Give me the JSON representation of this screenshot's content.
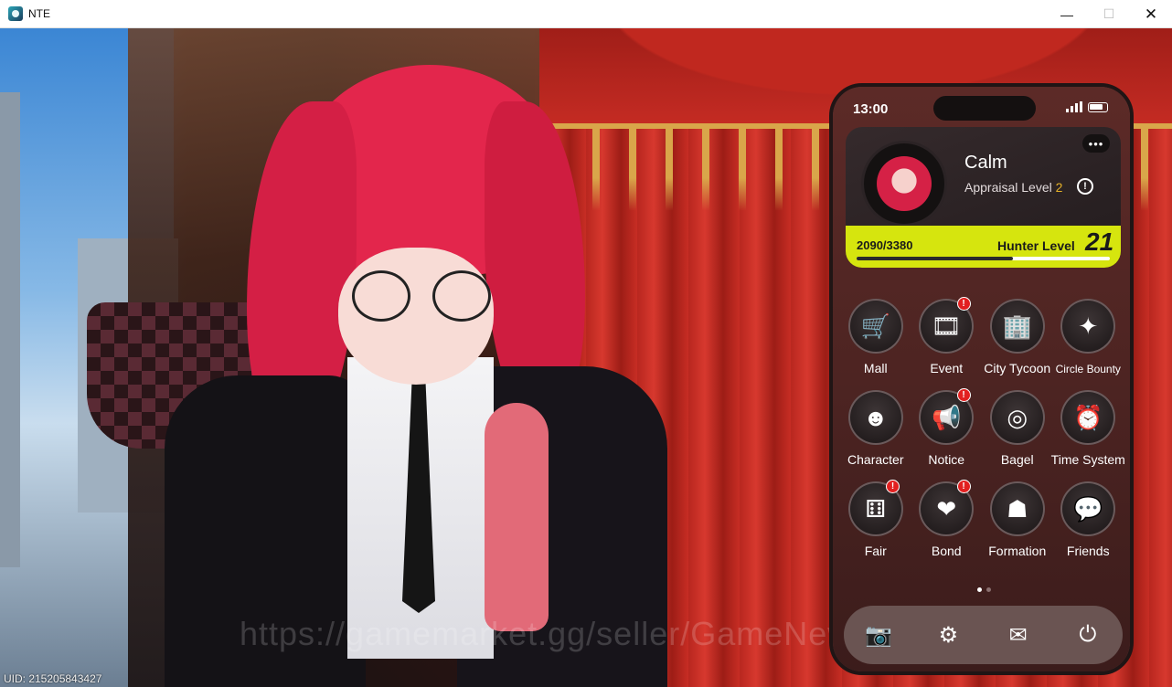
{
  "window": {
    "title": "NTE",
    "minimize": "—",
    "maximize": "☐",
    "close": "✕"
  },
  "game": {
    "watermark": "https://gamemarket.gg/seller/GameNews",
    "uid": "UID: 215205843427"
  },
  "phone": {
    "status_time": "13:00",
    "profile": {
      "name": "Calm",
      "appraisal_label": "Appraisal Level",
      "appraisal_value": "2",
      "more": "•••",
      "xp_text": "2090/3380",
      "xp_current": 2090,
      "xp_max": 3380,
      "hunter_label": "Hunter Level",
      "hunter_level": "21"
    },
    "apps": [
      {
        "label": "Mall",
        "icon": "cart-icon",
        "glyph": "🛒",
        "badge": false
      },
      {
        "label": "Event",
        "icon": "film-star-icon",
        "glyph": "🎞",
        "badge": true
      },
      {
        "label": "City Tycoon",
        "icon": "building-icon",
        "glyph": "🏢",
        "badge": false
      },
      {
        "label": "Circle Bounty",
        "icon": "bounty-icon",
        "glyph": "✦",
        "badge": false
      },
      {
        "label": "Character",
        "icon": "character-icon",
        "glyph": "☻",
        "badge": false
      },
      {
        "label": "Notice",
        "icon": "megaphone-icon",
        "glyph": "📢",
        "badge": true
      },
      {
        "label": "Bagel",
        "icon": "bagel-icon",
        "glyph": "◎",
        "badge": false
      },
      {
        "label": "Time System",
        "icon": "alarm-clock-icon",
        "glyph": "⏰",
        "badge": false
      },
      {
        "label": "Fair",
        "icon": "dice-icon",
        "glyph": "⚅",
        "badge": true
      },
      {
        "label": "Bond",
        "icon": "heart-flower-icon",
        "glyph": "❤",
        "badge": true
      },
      {
        "label": "Formation",
        "icon": "formation-icon",
        "glyph": "☗",
        "badge": false
      },
      {
        "label": "Friends",
        "icon": "chat-bubbles-icon",
        "glyph": "💬",
        "badge": false
      }
    ],
    "badge_glyph": "!",
    "page_dots": 2,
    "dock": [
      {
        "name": "camera-icon",
        "glyph": "📷"
      },
      {
        "name": "settings-gear-icon",
        "glyph": "⚙"
      },
      {
        "name": "mail-icon",
        "glyph": "✉"
      },
      {
        "name": "power-icon",
        "glyph": "⏻"
      }
    ]
  }
}
